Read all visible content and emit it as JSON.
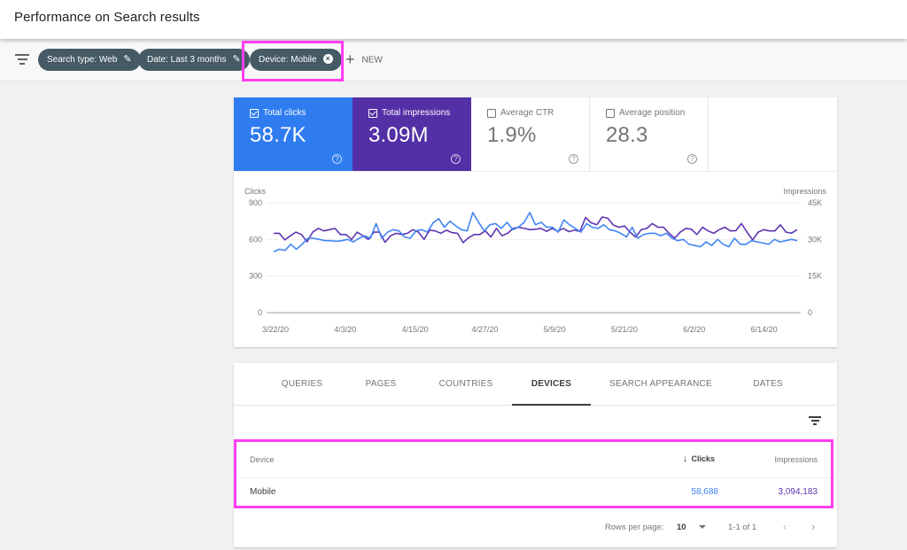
{
  "header": {
    "title": "Performance on Search results"
  },
  "filters": {
    "chips": [
      {
        "label": "Search type: Web",
        "icon": "pencil-icon"
      },
      {
        "label": "Date: Last 3 months",
        "icon": "pencil-icon"
      },
      {
        "label": "Device: Mobile",
        "icon": "close-circle-icon"
      }
    ],
    "new_label": "NEW"
  },
  "metrics": [
    {
      "label": "Total clicks",
      "value": "58.7K",
      "checked": true,
      "color": "#2f7cf0"
    },
    {
      "label": "Total impressions",
      "value": "3.09M",
      "checked": true,
      "color": "#5330a6"
    },
    {
      "label": "Average CTR",
      "value": "1.9%",
      "checked": false
    },
    {
      "label": "Average position",
      "value": "28.3",
      "checked": false
    }
  ],
  "chart_data": {
    "type": "line",
    "xlabel": "",
    "ylabel_left": "Clicks",
    "ylabel_right": "Impressions",
    "yticks_left": [
      "0",
      "300",
      "600",
      "900"
    ],
    "yticks_right": [
      "0",
      "15K",
      "30K",
      "45K"
    ],
    "ylim_left": [
      0,
      900
    ],
    "ylim_right": [
      0,
      45000
    ],
    "xticks": [
      "3/22/20",
      "4/3/20",
      "4/15/20",
      "4/27/20",
      "5/9/20",
      "5/21/20",
      "6/2/20",
      "6/14/20"
    ],
    "grid": true,
    "series": [
      {
        "name": "Clicks",
        "axis": "left",
        "color": "#4285f4",
        "values": [
          500,
          520,
          510,
          560,
          520,
          560,
          610,
          610,
          600,
          590,
          590,
          585,
          590,
          600,
          580,
          610,
          630,
          610,
          730,
          610,
          660,
          680,
          670,
          620,
          610,
          670,
          680,
          660,
          735,
          770,
          700,
          750,
          710,
          680,
          670,
          820,
          740,
          670,
          720,
          730,
          690,
          740,
          680,
          700,
          740,
          820,
          720,
          740,
          700,
          700,
          660,
          760,
          720,
          690,
          660,
          730,
          700,
          690,
          720,
          680,
          670,
          650,
          620,
          700,
          610,
          640,
          650,
          650,
          630,
          650,
          610,
          590,
          600,
          560,
          550,
          540,
          580,
          550,
          600,
          560,
          540,
          610,
          560,
          560,
          590,
          580,
          570,
          560,
          600,
          580,
          590,
          600,
          590
        ],
        "note": "approximate daily values read from chart"
      },
      {
        "name": "Impressions",
        "axis": "right",
        "color": "#5e35b1",
        "values": [
          32500,
          32500,
          29800,
          31500,
          33000,
          32000,
          29000,
          33000,
          34500,
          33500,
          34000,
          34500,
          32000,
          32000,
          30000,
          33000,
          31500,
          30000,
          33000,
          33000,
          28800,
          31500,
          32500,
          32000,
          32500,
          34000,
          33000,
          30000,
          33800,
          33500,
          32500,
          33800,
          32800,
          32500,
          28700,
          30700,
          32000,
          32000,
          33500,
          31000,
          34500,
          31500,
          32500,
          34500,
          35000,
          34500,
          34000,
          34200,
          34500,
          33300,
          34500,
          33300,
          34500,
          33200,
          33800,
          33300,
          39000,
          36800,
          36000,
          39200,
          38700,
          35900,
          35000,
          35500,
          33000,
          31000,
          34000,
          34500,
          36500,
          35000,
          35000,
          32500,
          30500,
          33000,
          34500,
          34200,
          32000,
          35000,
          33500,
          32500,
          34000,
          35000,
          33500,
          33600,
          36500,
          33000,
          29800,
          33000,
          34000,
          33500,
          33500,
          36000,
          33000,
          32600,
          34000
        ],
        "note": "approximate daily values read from chart"
      }
    ]
  },
  "tabs": [
    {
      "label": "QUERIES",
      "active": false
    },
    {
      "label": "PAGES",
      "active": false
    },
    {
      "label": "COUNTRIES",
      "active": false
    },
    {
      "label": "DEVICES",
      "active": true
    },
    {
      "label": "SEARCH APPEARANCE",
      "active": false
    },
    {
      "label": "DATES",
      "active": false
    }
  ],
  "table": {
    "columns": {
      "device": "Device",
      "clicks": "Clicks",
      "impressions": "Impressions",
      "sort_icon": "arrow-down-icon"
    },
    "rows": [
      {
        "device": "Mobile",
        "clicks": "58,688",
        "impressions": "3,094,183"
      }
    ],
    "colors": {
      "clicks": "#4285f4",
      "impressions": "#5e35b1"
    }
  },
  "pagination": {
    "rows_per_page_label": "Rows per page:",
    "rows_per_page": "10",
    "range": "1-1 of 1"
  }
}
